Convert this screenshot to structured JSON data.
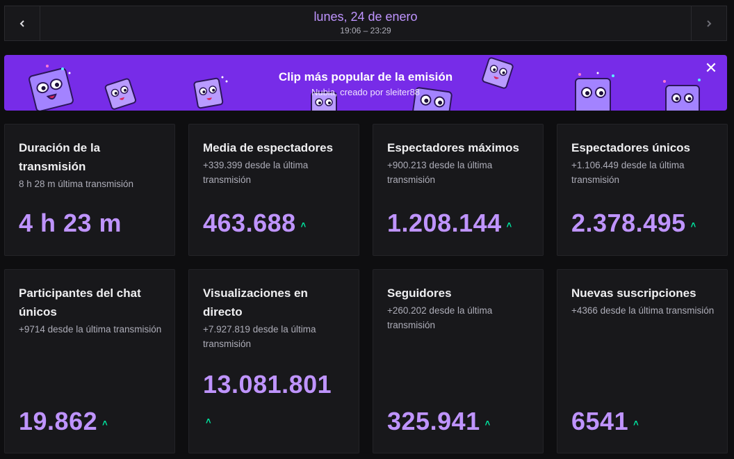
{
  "header": {
    "date": "lunes, 24 de enero",
    "time_range": "19:06 – 23:29",
    "prev_icon": "chevron-left-icon",
    "next_icon": "chevron-right-icon"
  },
  "banner": {
    "title": "Clip más popular de la emisión",
    "subtitle": "Nubia, creado por sleiter88",
    "close_icon": "close-icon",
    "bg_color": "#772ce8"
  },
  "stats": [
    {
      "title": "Duración de la transmisión",
      "sub": "8 h 28 m última transmisión",
      "value": "4 h 23 m",
      "trend": ""
    },
    {
      "title": "Media de espectadores",
      "sub": "+339.399 desde la última transmisión",
      "value": "463.688",
      "trend": "up"
    },
    {
      "title": "Espectadores máximos",
      "sub": "+900.213 desde la última transmisión",
      "value": "1.208.144",
      "trend": "up"
    },
    {
      "title": "Espectadores únicos",
      "sub": "+1.106.449 desde la última transmisión",
      "value": "2.378.495",
      "trend": "up"
    },
    {
      "title": "Participantes del chat únicos",
      "sub": "+9714 desde la última transmisión",
      "value": "19.862",
      "trend": "up"
    },
    {
      "title": "Visualizaciones en directo",
      "sub": "+7.927.819 desde la última transmisión",
      "value": "13.081.801",
      "trend": "up"
    },
    {
      "title": "Seguidores",
      "sub": "+260.202 desde la última transmisión",
      "value": "325.941",
      "trend": "up"
    },
    {
      "title": "Nuevas suscripciones",
      "sub": "+4366 desde la última transmisión",
      "value": "6541",
      "trend": "up"
    }
  ],
  "colors": {
    "accent": "#bf94ff",
    "trend_up": "#00e6a0",
    "card_bg": "#18181b",
    "page_bg": "#0e0e10"
  }
}
